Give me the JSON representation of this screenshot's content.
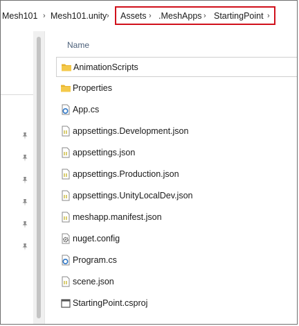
{
  "breadcrumb": {
    "items": [
      "Mesh101",
      "Mesh101.unity",
      "Assets",
      ".MeshApps",
      "StartingPoint"
    ],
    "separator": "›",
    "highlight_color": "#d0101b"
  },
  "list": {
    "column_header": "Name",
    "items": [
      {
        "name": "AnimationScripts",
        "icon": "folder-icon",
        "selected": true
      },
      {
        "name": "Properties",
        "icon": "folder-icon"
      },
      {
        "name": "App.cs",
        "icon": "csharp-file-icon"
      },
      {
        "name": "appsettings.Development.json",
        "icon": "json-file-icon"
      },
      {
        "name": "appsettings.json",
        "icon": "json-file-icon"
      },
      {
        "name": "appsettings.Production.json",
        "icon": "json-file-icon"
      },
      {
        "name": "appsettings.UnityLocalDev.json",
        "icon": "json-file-icon"
      },
      {
        "name": "meshapp.manifest.json",
        "icon": "json-file-icon"
      },
      {
        "name": "nuget.config",
        "icon": "config-file-icon"
      },
      {
        "name": "Program.cs",
        "icon": "csharp-file-icon"
      },
      {
        "name": "scene.json",
        "icon": "json-file-icon"
      },
      {
        "name": "StartingPoint.csproj",
        "icon": "csproj-file-icon"
      }
    ]
  },
  "colors": {
    "folder": "#e8b530",
    "json_accent": "#c9b838",
    "cs_accent": "#2e77c7",
    "header_text": "#4c607a"
  }
}
